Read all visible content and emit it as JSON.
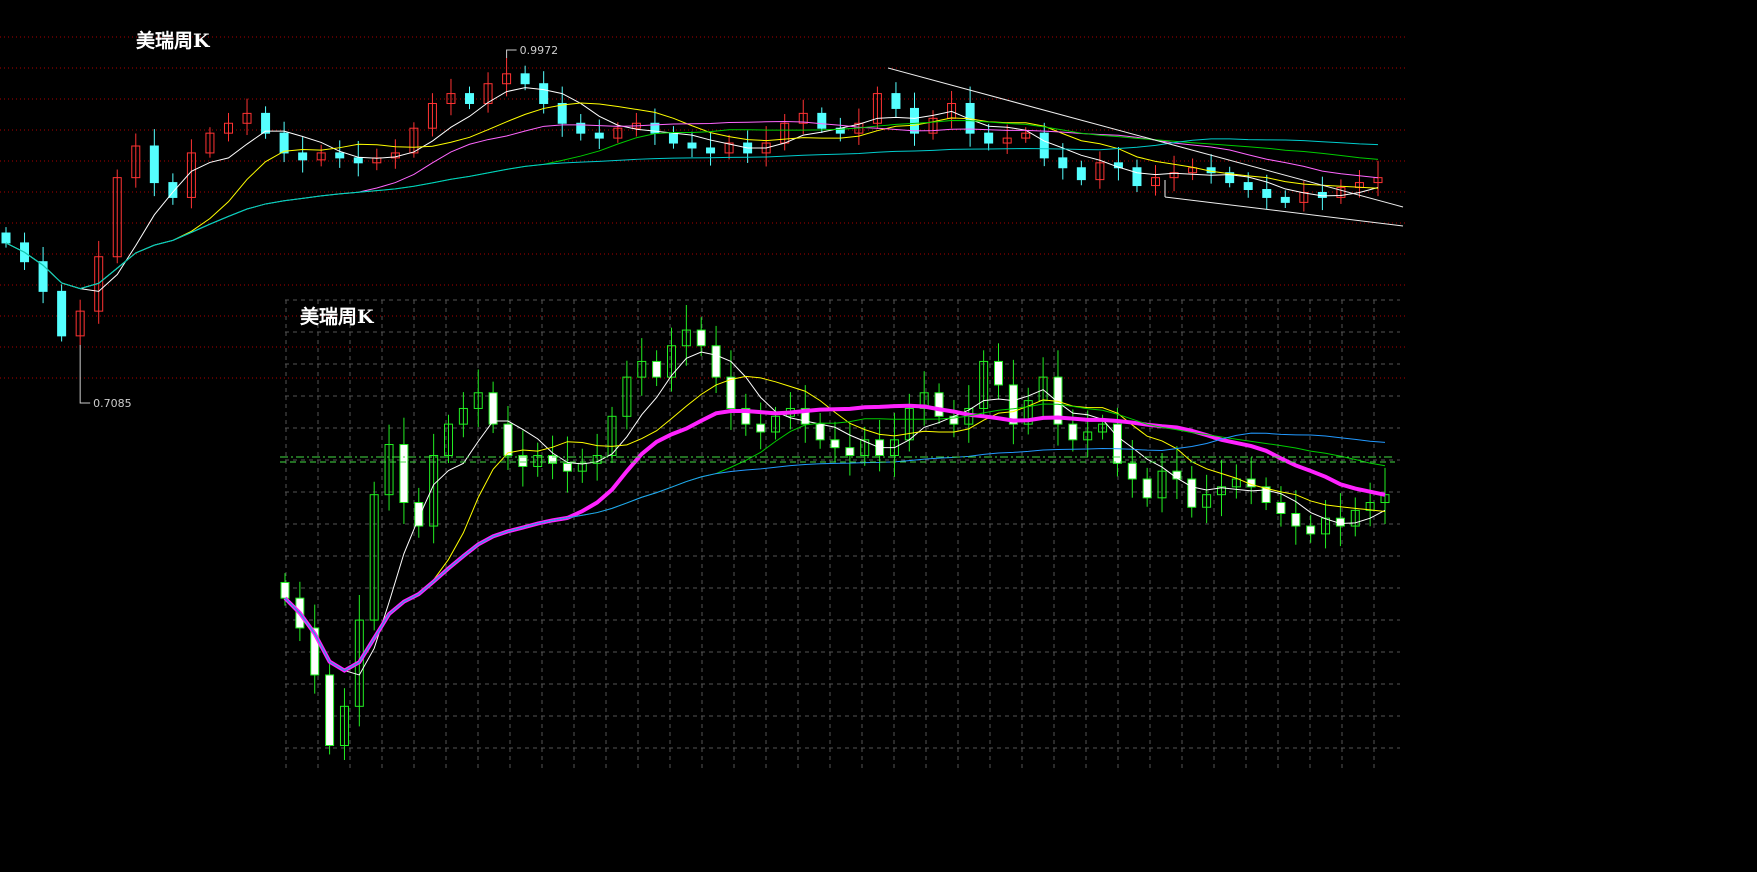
{
  "chart_data": [
    {
      "type": "candlestick",
      "title": "美瑞周K",
      "style": "red-up / cyan-down, dotted red grid",
      "high_label": "0.9972",
      "low_label": "0.7085",
      "closes": [
        0.814,
        0.795,
        0.765,
        0.72,
        0.745,
        0.8,
        0.88,
        0.912,
        0.875,
        0.86,
        0.905,
        0.925,
        0.935,
        0.945,
        0.925,
        0.905,
        0.898,
        0.905,
        0.9,
        0.895,
        0.9,
        0.905,
        0.93,
        0.955,
        0.965,
        0.955,
        0.975,
        0.985,
        0.975,
        0.955,
        0.935,
        0.925,
        0.92,
        0.93,
        0.935,
        0.925,
        0.915,
        0.91,
        0.905,
        0.915,
        0.905,
        0.915,
        0.935,
        0.945,
        0.93,
        0.925,
        0.935,
        0.965,
        0.95,
        0.925,
        0.94,
        0.955,
        0.925,
        0.915,
        0.92,
        0.925,
        0.9,
        0.89,
        0.878,
        0.895,
        0.89,
        0.872,
        0.88,
        0.885,
        0.89,
        0.885,
        0.875,
        0.868,
        0.86,
        0.855,
        0.865,
        0.86,
        0.87,
        0.875,
        0.88
      ],
      "moving_averages": [
        5,
        10,
        20,
        30,
        60,
        120
      ],
      "ma_colors": [
        "#ffffff",
        "#ffff00",
        "#ff66ff",
        "#00cc00",
        "#00cccc"
      ],
      "up_color": "#ff3333",
      "down_color": "#55ffff"
    },
    {
      "type": "candlestick",
      "title": "美瑞周K",
      "style": "green outline / white body, dashed gray grid",
      "moving_averages": [
        5,
        10,
        20,
        30,
        60
      ],
      "ma_colors": [
        "#ffffff",
        "#ffff00",
        "#ff22ff",
        "#00cc00",
        "#2299ff"
      ],
      "up_color": "#22ee22",
      "down_color": "#ffffff",
      "reference_line_color": "#44dd44"
    }
  ]
}
